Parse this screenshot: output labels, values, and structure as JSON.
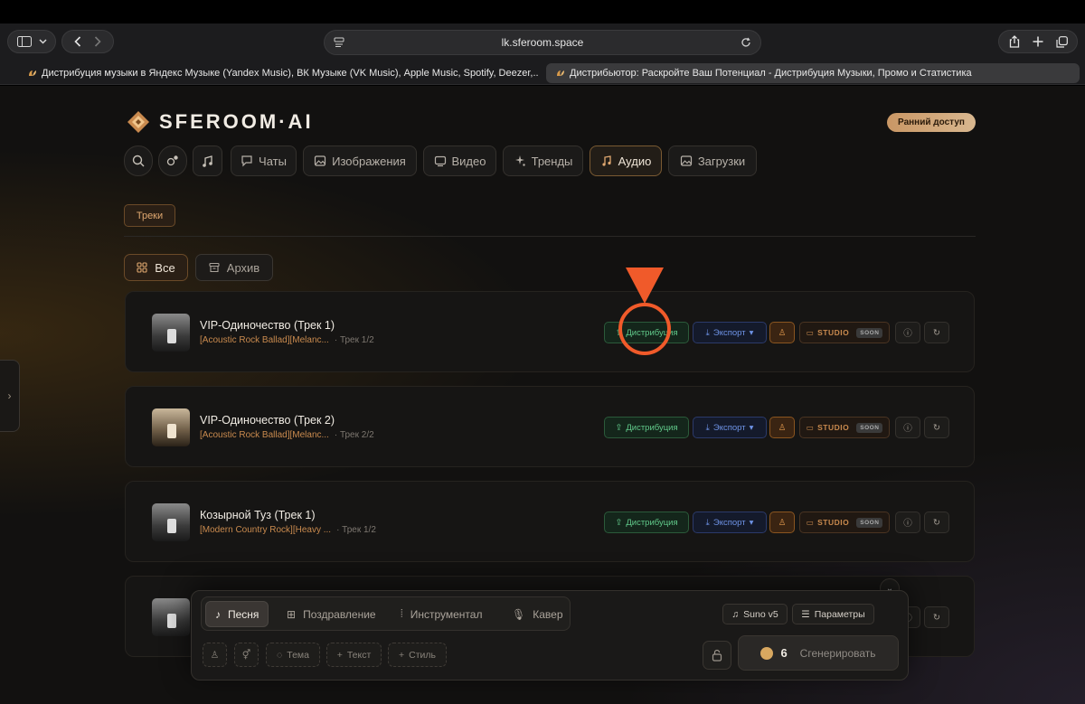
{
  "browser": {
    "url": "lk.sferoom.space",
    "tabs": [
      {
        "title": "Дистрибуция музыки в Яндекс Музыке (Yandex Music), ВК Музыке (VK Music), Apple Music, Spotify, Deezer,...",
        "active": false
      },
      {
        "title": "Дистрибьютор: Раскройте Ваш Потенциал - Дистрибуция Музыки, Промо и Статистика",
        "active": true
      }
    ]
  },
  "header": {
    "logo_text": "SFEROOM·AI",
    "early_access": "Ранний доступ"
  },
  "nav": {
    "items": [
      {
        "label": "Чаты",
        "icon": "chat-icon"
      },
      {
        "label": "Изображения",
        "icon": "image-icon"
      },
      {
        "label": "Видео",
        "icon": "video-icon"
      },
      {
        "label": "Тренды",
        "icon": "trends-icon"
      },
      {
        "label": "Аудио",
        "icon": "music-note-icon",
        "active": true
      },
      {
        "label": "Загрузки",
        "icon": "image-icon"
      }
    ]
  },
  "subnav": {
    "tracks": "Треки"
  },
  "filters": {
    "all": "Все",
    "archive": "Архив"
  },
  "tracks": [
    {
      "title": "VIP-Одиночество (Трек 1)",
      "tags": "[Acoustic Rock Ballad][Melanc...",
      "track": "· Трек 1/2"
    },
    {
      "title": "VIP-Одиночество (Трек 2)",
      "tags": "[Acoustic Rock Ballad][Melanc...",
      "track": "· Трек 2/2"
    },
    {
      "title": "Козырной Туз (Трек 1)",
      "tags": "[Modern Country Rock][Heavy ...",
      "track": "· Трек 1/2"
    }
  ],
  "actions": {
    "distribution": "Дистрибуция",
    "export": "Экспорт",
    "studio": "STUDIO",
    "soon": "SOON"
  },
  "composer": {
    "modes": [
      "Песня",
      "Поздравление",
      "Инструментал",
      "Кавер"
    ],
    "model": "Suno v5",
    "params": "Параметры",
    "chips": {
      "theme": "Тема",
      "text": "Текст",
      "style": "Стиль"
    },
    "cost": "6",
    "generate": "Сгенерировать"
  },
  "colors": {
    "accent": "#e0a870",
    "annotation": "#f05a2a",
    "distribution": "#61c98a",
    "export": "#6e93e6"
  }
}
